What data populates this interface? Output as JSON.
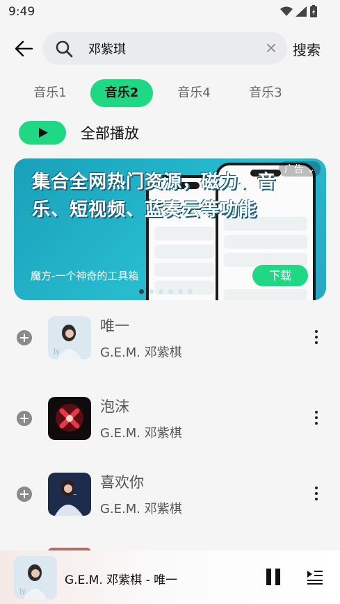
{
  "status": {
    "time": "9:49"
  },
  "search": {
    "query": "邓紫琪",
    "button_label": "搜索"
  },
  "tabs": [
    {
      "label": "音乐1",
      "active": false
    },
    {
      "label": "音乐2",
      "active": true
    },
    {
      "label": "音乐4",
      "active": false
    },
    {
      "label": "音乐3",
      "active": false
    }
  ],
  "play_all": {
    "label": "全部播放"
  },
  "banner": {
    "headline": "集合全网热门资源，磁力、音乐、短视频、蓝奏云等功能",
    "ad_label": "广告",
    "subtitle": "魔方-一个神奇的工具箱",
    "download_label": "下载",
    "slide_count": 6,
    "active_slide": 0
  },
  "songs": [
    {
      "title": "唯一",
      "artist": "G.E.M. 邓紫棋"
    },
    {
      "title": "泡沫",
      "artist": "G.E.M. 邓紫棋"
    },
    {
      "title": "喜欢你",
      "artist": "G.E.M. 邓紫棋"
    }
  ],
  "player": {
    "now_playing": "G.E.M. 邓紫棋 - 唯一"
  },
  "colors": {
    "accent": "#1ed884",
    "banner": "#22b3c8"
  }
}
